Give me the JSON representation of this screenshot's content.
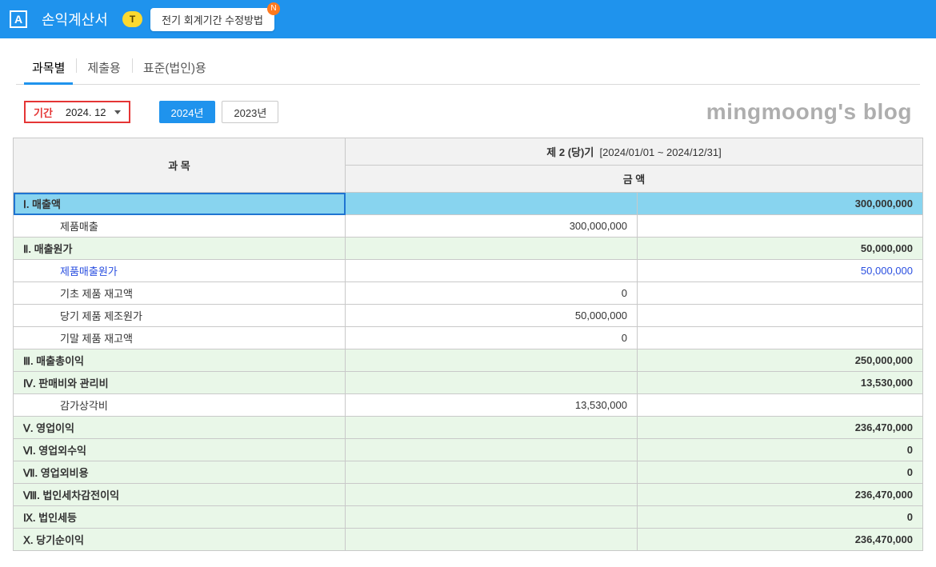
{
  "header": {
    "app_icon_letter": "A",
    "title": "손익계산서",
    "t_badge": "T",
    "info_chip": "전기 회계기간 수정방법",
    "n_badge": "N"
  },
  "tabs": [
    {
      "label": "과목별",
      "active": true
    },
    {
      "label": "제출용",
      "active": false
    },
    {
      "label": "표준(법인)용",
      "active": false
    }
  ],
  "controls": {
    "period_label": "기간",
    "period_value": "2024. 12",
    "year_buttons": [
      {
        "label": "2024년",
        "active": true
      },
      {
        "label": "2023년",
        "active": false
      }
    ],
    "watermark": "mingmoong's blog"
  },
  "table": {
    "headers": {
      "item": "과 목",
      "period_title": "제 2 (당)기",
      "period_range": "[2024/01/01 ~ 2024/12/31]",
      "amount": "금 액"
    },
    "rows": [
      {
        "level": 0,
        "label": "Ⅰ. 매출액",
        "sub": "",
        "total": "300,000,000",
        "selected": true
      },
      {
        "level": 1,
        "label": "제품매출",
        "sub": "300,000,000",
        "total": ""
      },
      {
        "level": 0,
        "label": "Ⅱ. 매출원가",
        "sub": "",
        "total": "50,000,000"
      },
      {
        "level": 1,
        "label": "제품매출원가",
        "sub": "",
        "total": "50,000,000",
        "link": true
      },
      {
        "level": 1,
        "label": "기초 제품 재고액",
        "sub": "0",
        "total": ""
      },
      {
        "level": 1,
        "label": "당기 제품 제조원가",
        "sub": "50,000,000",
        "total": ""
      },
      {
        "level": 1,
        "label": "기말 제품 재고액",
        "sub": "0",
        "total": ""
      },
      {
        "level": 0,
        "label": "Ⅲ. 매출총이익",
        "sub": "",
        "total": "250,000,000"
      },
      {
        "level": 0,
        "label": "Ⅳ. 판매비와 관리비",
        "sub": "",
        "total": "13,530,000"
      },
      {
        "level": 1,
        "label": "감가상각비",
        "sub": "13,530,000",
        "total": ""
      },
      {
        "level": 0,
        "label": "Ⅴ. 영업이익",
        "sub": "",
        "total": "236,470,000"
      },
      {
        "level": 0,
        "label": "Ⅵ. 영업외수익",
        "sub": "",
        "total": "0"
      },
      {
        "level": 0,
        "label": "Ⅶ. 영업외비용",
        "sub": "",
        "total": "0"
      },
      {
        "level": 0,
        "label": "Ⅷ. 법인세차감전이익",
        "sub": "",
        "total": "236,470,000"
      },
      {
        "level": 0,
        "label": "Ⅸ. 법인세등",
        "sub": "",
        "total": "0"
      },
      {
        "level": 0,
        "label": "Ⅹ. 당기순이익",
        "sub": "",
        "total": "236,470,000"
      }
    ]
  }
}
